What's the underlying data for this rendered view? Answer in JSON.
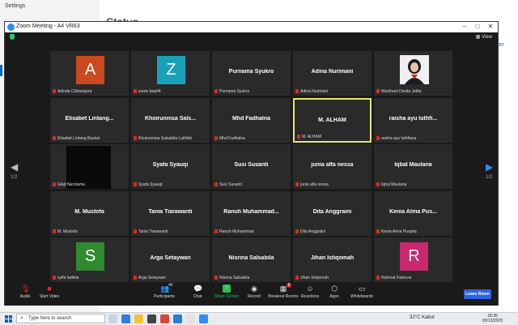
{
  "background_window": {
    "title": "Settings",
    "heading": "Status",
    "link_text": "ver"
  },
  "zoom": {
    "title": "Zoom Meeting - A4 VR63",
    "view_label": "View",
    "page_left": "1/2",
    "page_right": "1/2",
    "participants": [
      {
        "name": "Adinda Chikanaura",
        "label": "Adinda Chikanaura",
        "avatar": "A",
        "avatar_color": "#c94a1e",
        "kind": "avatar"
      },
      {
        "name": "zoom baa04",
        "label": "zoom baa04",
        "avatar": "Z",
        "avatar_color": "#1aa1b8",
        "kind": "avatar"
      },
      {
        "name": "Purnama Syukro",
        "label": "Purnama Syukro",
        "kind": "name"
      },
      {
        "name": "Adina Nurimani",
        "label": "Adina Nurimani",
        "kind": "name"
      },
      {
        "name": "Wunihani Devita Jelita",
        "label": "Wunihani Devita Jelita",
        "kind": "photo"
      },
      {
        "name": "Elisabet Lintang...",
        "label": "Elisabet Lintang Bastari",
        "kind": "name"
      },
      {
        "name": "Khoirunnisa Sals...",
        "label": "Khoirunnisa Salsabila Luthfah",
        "kind": "name"
      },
      {
        "name": "Mhd Fadhalna",
        "label": "Mhd Fadhalna",
        "kind": "name"
      },
      {
        "name": "M. ALHAM",
        "label": "M. ALHAM",
        "kind": "name",
        "speaking": true
      },
      {
        "name": "raisha ayu luthfi...",
        "label": "raisha ayu luthfiana",
        "kind": "name"
      },
      {
        "name": "Glad Narotama",
        "label": "Glad Narotama",
        "kind": "video"
      },
      {
        "name": "Syafa Syauqi",
        "label": "Syafa Syauqi",
        "kind": "name"
      },
      {
        "name": "Susi Susanti",
        "label": "Susi Susanti",
        "kind": "name"
      },
      {
        "name": "junia alfa nessa",
        "label": "junia alfa nessa",
        "kind": "name"
      },
      {
        "name": "Iqbal Maulana",
        "label": "Iqbal Maulana",
        "kind": "name"
      },
      {
        "name": "M. Mustofa",
        "label": "M. Mustofa",
        "kind": "name"
      },
      {
        "name": "Tania Tiarawanti",
        "label": "Tania Tiarawanti",
        "kind": "name"
      },
      {
        "name": "Ranuh Muhammad...",
        "label": "Ranuh Muhammad",
        "kind": "name"
      },
      {
        "name": "Dita Anggraini",
        "label": "Dita Anggraini",
        "kind": "name"
      },
      {
        "name": "Kenia Atma Pus...",
        "label": "Kenia Atma Puspita",
        "kind": "name"
      },
      {
        "name": "syifa fadhila",
        "label": "syifa fadhila",
        "avatar": "S",
        "avatar_color": "#2e8b2e",
        "kind": "avatar"
      },
      {
        "name": "Arga Setaywan",
        "label": "Arga Setaywan",
        "kind": "name"
      },
      {
        "name": "Nisrina Salsabila",
        "label": "Nisrina Salsabila",
        "kind": "name"
      },
      {
        "name": "Jihan Istiqomah",
        "label": "Jihan Istiqomah",
        "kind": "name"
      },
      {
        "name": "Rahmat Fahreza",
        "label": "Rahmat Fahreza",
        "avatar": "R",
        "avatar_color": "#c8286e",
        "kind": "avatar"
      }
    ],
    "toolbar": {
      "audio": "Audio",
      "start_video": "Start Video",
      "participants": "Participants",
      "participants_count": "40",
      "chat": "Chat",
      "share_screen": "Share Screen",
      "record": "Record",
      "breakout_rooms": "Breakout Rooms",
      "breakout_badge": "5",
      "reactions": "Reactions",
      "apps": "Apps",
      "whiteboards": "Whiteboards",
      "leave": "Leave Room"
    }
  },
  "taskbar": {
    "search_placeholder": "Type here to search",
    "weather": "32°C  Kabut",
    "time": "18:35",
    "date": "05/13/2023"
  }
}
